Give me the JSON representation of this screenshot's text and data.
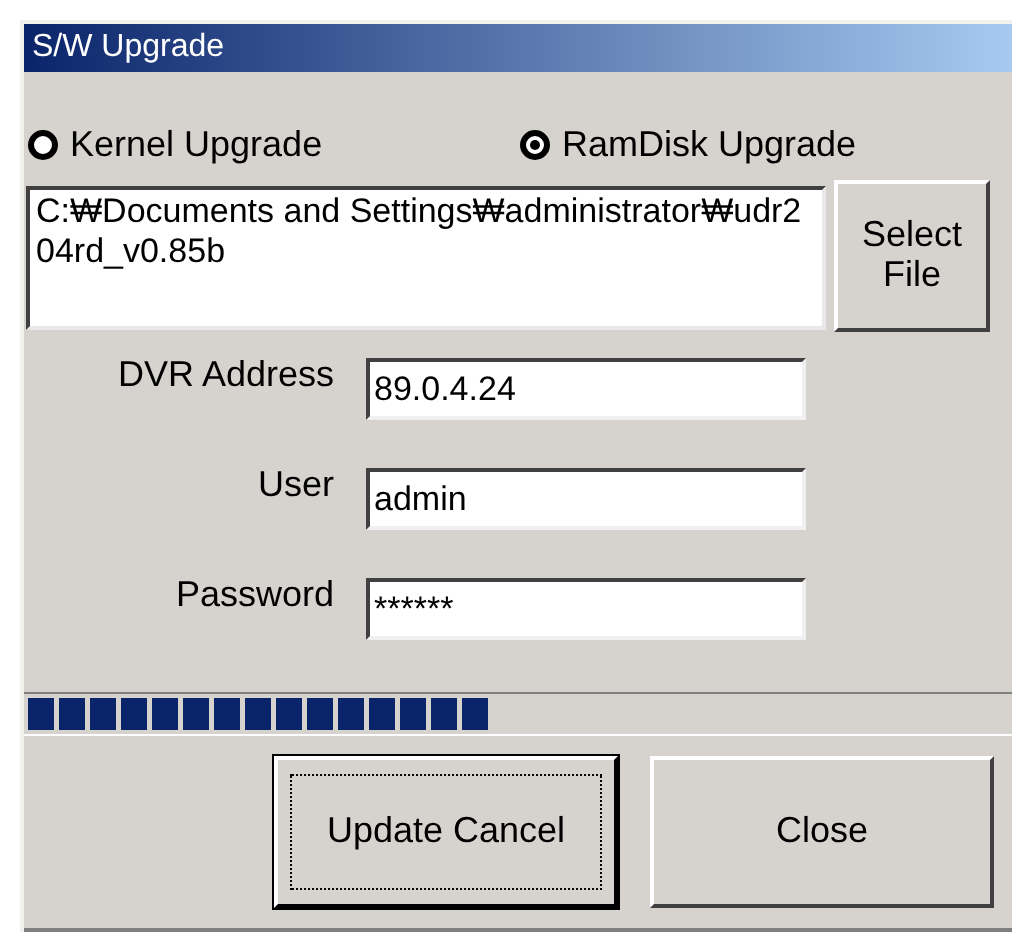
{
  "window": {
    "title": "S/W Upgrade"
  },
  "upgrade_type": [
    {
      "label": "Kernel Upgrade",
      "selected": false
    },
    {
      "label": "RamDisk Upgrade",
      "selected": true
    }
  ],
  "file": {
    "path": "C:₩Documents and Settings₩administrator₩udr204rd_v0.85b",
    "button": "Select File"
  },
  "fields": [
    {
      "label": "DVR Address",
      "value": "89.0.4.24"
    },
    {
      "label": "User",
      "value": "admin"
    },
    {
      "label": "Password",
      "value": "******"
    }
  ],
  "progress": {
    "level": 0.47
  },
  "buttons": [
    {
      "label": "Update Cancel",
      "focused": true
    },
    {
      "label": "Close",
      "focused": false
    }
  ]
}
